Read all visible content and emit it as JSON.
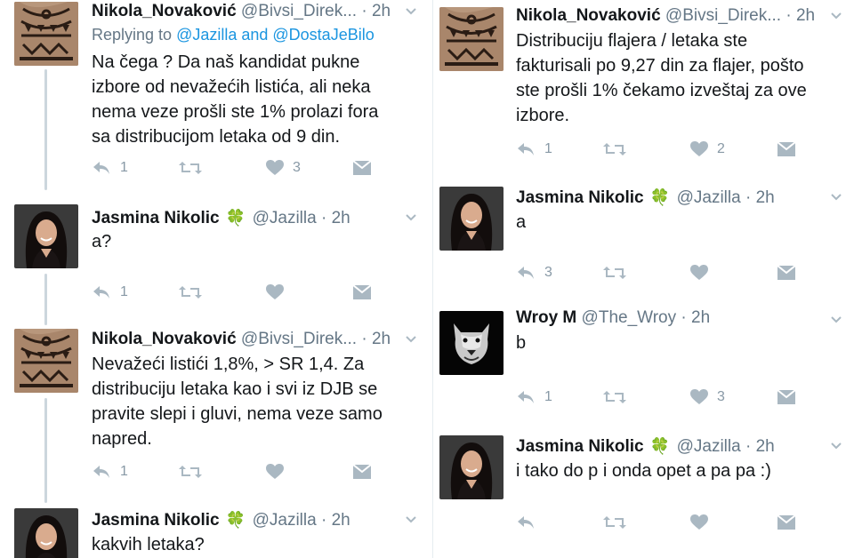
{
  "colors": {
    "name": "#14171a",
    "meta": "#657786",
    "link": "#1b95e0",
    "action": "#aab8c2",
    "clover": "#5aa33b",
    "thread": "#ccd6dd"
  },
  "icons": {
    "reply": "reply-icon",
    "retweet": "retweet-icon",
    "like": "heart-icon",
    "dm": "envelope-icon",
    "menu": "chevron-down-icon",
    "verified": "four-leaf-clover-icon"
  },
  "left": {
    "t1": {
      "name": "Nikola_Novaković",
      "handle": "@Bivsi_Direk...",
      "dot": "·",
      "time": "2h",
      "replying_prefix": "Replying to",
      "replying_mentions": "@Jazilla and @DostaJeBilo",
      "lines": [
        "Na čega ? Da naš kandidat pukne",
        "izbore od nevažećih listića, ali neka",
        "nema veze prošli ste 1% prolazi fora",
        "sa distribucijom letaka od 9 din."
      ],
      "replies": "1",
      "retweets": "",
      "likes": "3"
    },
    "t2": {
      "name": "Jasmina Nikolic",
      "clover": "🍀",
      "handle": "@Jazilla",
      "dot": "·",
      "time": "2h",
      "lines": [
        "a?"
      ],
      "replies": "1",
      "retweets": "",
      "likes": ""
    },
    "t3": {
      "name": "Nikola_Novaković",
      "handle": "@Bivsi_Direk...",
      "dot": "·",
      "time": "2h",
      "lines": [
        "Nevažeći listići 1,8%, > SR 1,4. Za",
        "distribuciju letaka kao i svi iz DJB se",
        "pravite slepi i gluvi, nema veze samo",
        "napred."
      ],
      "replies": "1",
      "retweets": "",
      "likes": ""
    },
    "t4": {
      "name": "Jasmina Nikolic",
      "clover": "🍀",
      "handle": "@Jazilla",
      "dot": "·",
      "time": "2h",
      "lines": [
        "kakvih letaka?"
      ]
    }
  },
  "right": {
    "t1": {
      "name": "Nikola_Novaković",
      "handle": "@Bivsi_Direk...",
      "dot": "·",
      "time": "2h",
      "lines": [
        "Distribuciju flajera / letaka ste",
        "fakturisali po 9,27 din za flajer, pošto",
        "ste prošli 1% čekamo izveštaj za ove",
        "izbore."
      ],
      "replies": "1",
      "retweets": "",
      "likes": "2"
    },
    "t2": {
      "name": "Jasmina Nikolic",
      "clover": "🍀",
      "handle": "@Jazilla",
      "dot": "·",
      "time": "2h",
      "lines": [
        "a"
      ],
      "replies": "3",
      "retweets": "",
      "likes": ""
    },
    "t3": {
      "name": "Wroy M",
      "handle": "@The_Wroy",
      "dot": "·",
      "time": "2h",
      "lines": [
        "b"
      ],
      "replies": "1",
      "retweets": "",
      "likes": "3"
    },
    "t4": {
      "name": "Jasmina Nikolic",
      "clover": "🍀",
      "handle": "@Jazilla",
      "dot": "·",
      "time": "2h",
      "lines": [
        "i tako do p i onda opet a pa pa :)"
      ],
      "replies": "",
      "retweets": "",
      "likes": ""
    }
  }
}
